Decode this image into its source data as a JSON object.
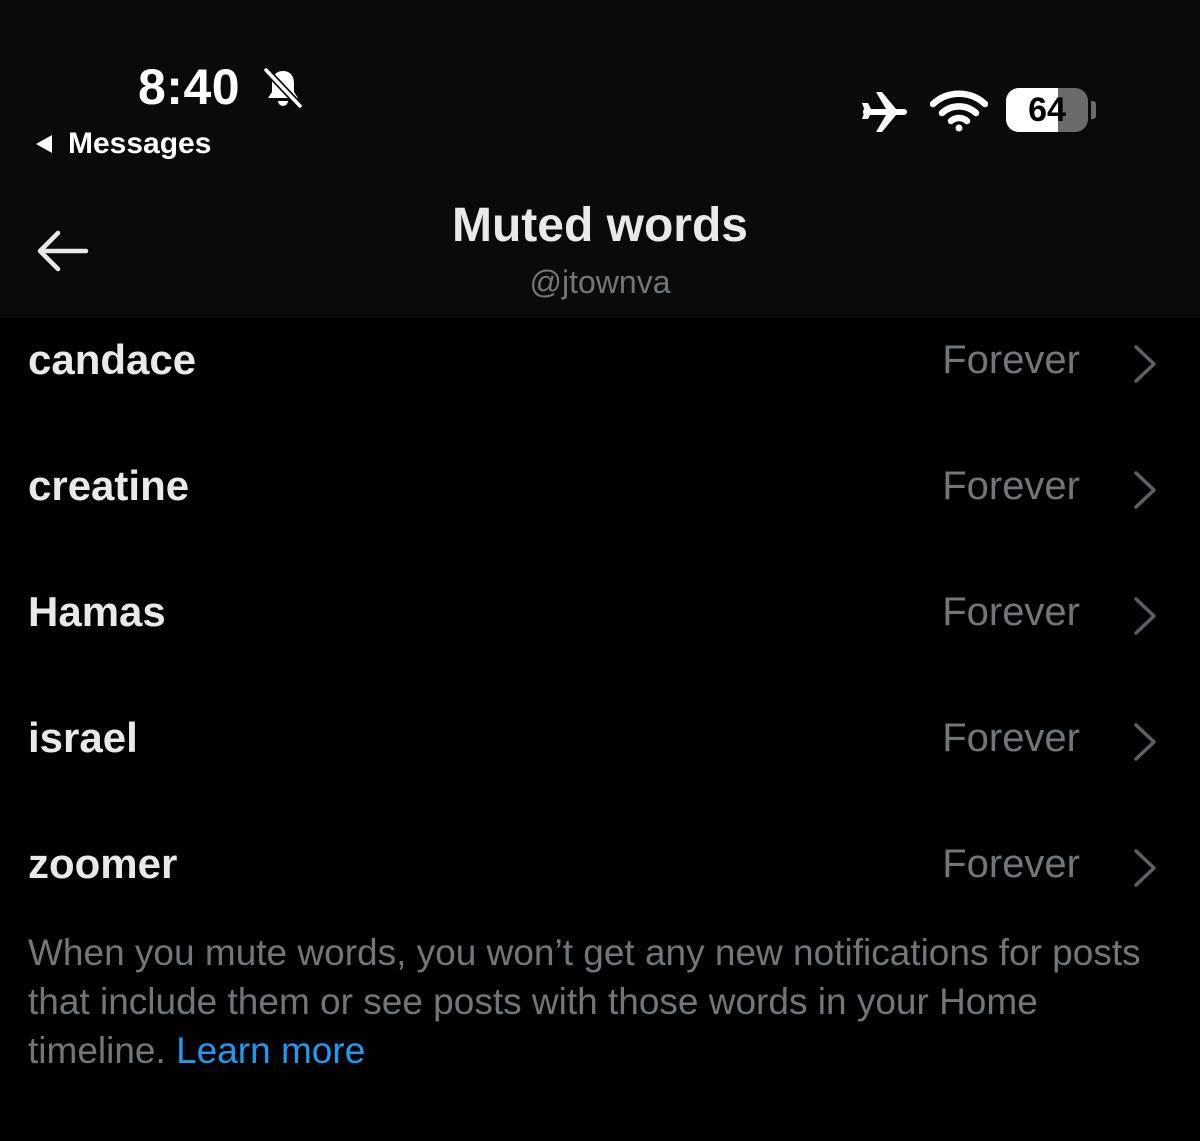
{
  "status_bar": {
    "time": "8:40",
    "back_app_label": "Messages",
    "battery_level": "64",
    "battery_fraction": 0.64,
    "icons": [
      "bell-off-icon",
      "airplane-icon",
      "wifi-icon",
      "battery-icon"
    ]
  },
  "header": {
    "title": "Muted words",
    "subtitle": "@jtownva",
    "back_icon": "arrow-left-icon"
  },
  "muted_words": [
    {
      "word": "candace",
      "duration": "Forever"
    },
    {
      "word": "creatine",
      "duration": "Forever"
    },
    {
      "word": "Hamas",
      "duration": "Forever"
    },
    {
      "word": "israel",
      "duration": "Forever"
    },
    {
      "word": "zoomer",
      "duration": "Forever"
    }
  ],
  "footer": {
    "explanation": "When you mute words, you won’t get any new notifications for posts that include them or see posts with those words in your Home timeline.",
    "learn_more": "Learn more"
  },
  "colors": {
    "background": "#000000",
    "header_background": "#0a0a0a",
    "primary_text": "#e7e9ea",
    "secondary_text": "#71767b",
    "link": "#1d9bf0"
  }
}
